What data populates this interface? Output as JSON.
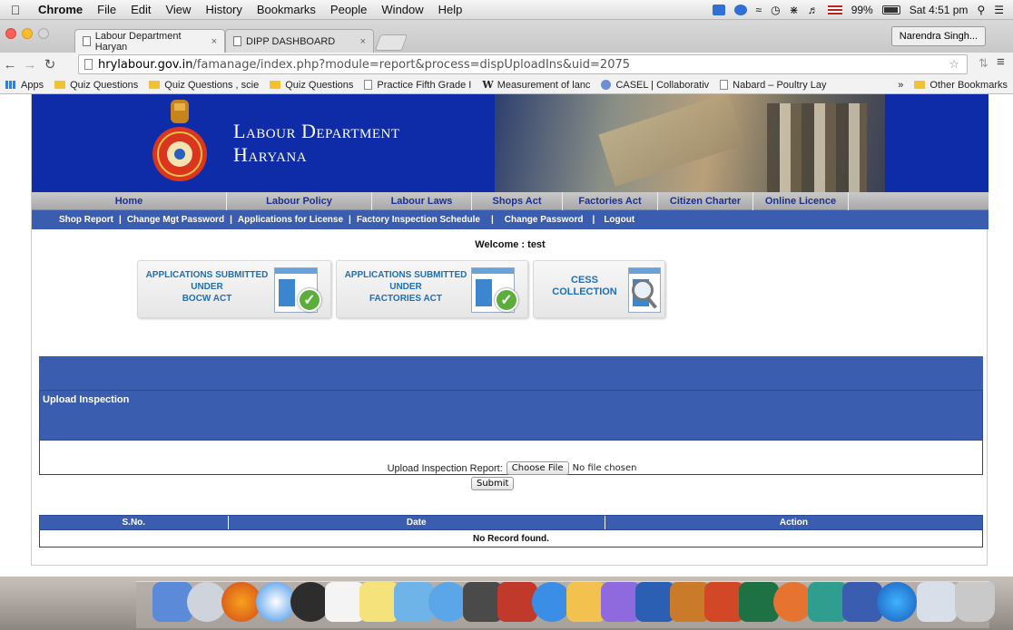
{
  "menubar": {
    "app": "Chrome",
    "items": [
      "File",
      "Edit",
      "View",
      "History",
      "Bookmarks",
      "People",
      "Window",
      "Help"
    ],
    "battery": "99%",
    "clock": "Sat 4:51 pm"
  },
  "tabs": [
    {
      "label": "Labour Department Haryan",
      "active": true
    },
    {
      "label": "DIPP DASHBOARD",
      "active": false
    }
  ],
  "profile": "Narendra Singh...",
  "address": {
    "host": "hrylabour.gov.in",
    "path": "/famanage/index.php?module=report&process=dispUploadIns&uid=2075"
  },
  "bookmarks": {
    "items": [
      {
        "icon": "apps",
        "label": "Apps"
      },
      {
        "icon": "folder",
        "label": "Quiz Questions"
      },
      {
        "icon": "folder",
        "label": "Quiz Questions , scie"
      },
      {
        "icon": "folder",
        "label": "Quiz Questions"
      },
      {
        "icon": "page",
        "label": "Practice Fifth Grade I"
      },
      {
        "icon": "w",
        "label": "Measurement of lanc"
      },
      {
        "icon": "casel",
        "label": "CASEL | Collaborativ"
      },
      {
        "icon": "page",
        "label": "Nabard – Poultry Lay"
      }
    ],
    "overflow": "»",
    "other": "Other Bookmarks"
  },
  "site": {
    "title_line1": "Labour Department",
    "title_line2": "Haryana",
    "main_nav": [
      "Home",
      "Labour Policy",
      "Labour Laws",
      "Shops Act",
      "Factories Act",
      "Citizen Charter",
      "Online Licence"
    ],
    "sub_nav": [
      "Shop Report",
      "Change Mgt Password",
      "Applications for License",
      "Factory Inspection Schedule",
      "Change Password",
      "Logout"
    ],
    "welcome": "Welcome : test",
    "cards": [
      {
        "line1": "APPLICATIONS SUBMITTED",
        "line2": "UNDER",
        "line3": "BOCW ACT"
      },
      {
        "line1": "APPLICATIONS SUBMITTED",
        "line2": "UNDER",
        "line3": "FACTORIES ACT"
      },
      {
        "line1": "CESS",
        "line2": "COLLECTION"
      }
    ],
    "upload_heading": "Upload Inspection",
    "upload_label": "Upload Inspection Report:",
    "choose_file": "Choose File",
    "no_file": "No file chosen",
    "submit": "Submit",
    "table": {
      "columns": [
        "S.No.",
        "Date",
        "Action"
      ],
      "empty": "No Record found."
    }
  },
  "colors": {
    "banner": "#0f2ca8",
    "nav_blue": "#3b5db0",
    "nav_text": "#1d2f8f",
    "card_text": "#1f6fb5"
  }
}
